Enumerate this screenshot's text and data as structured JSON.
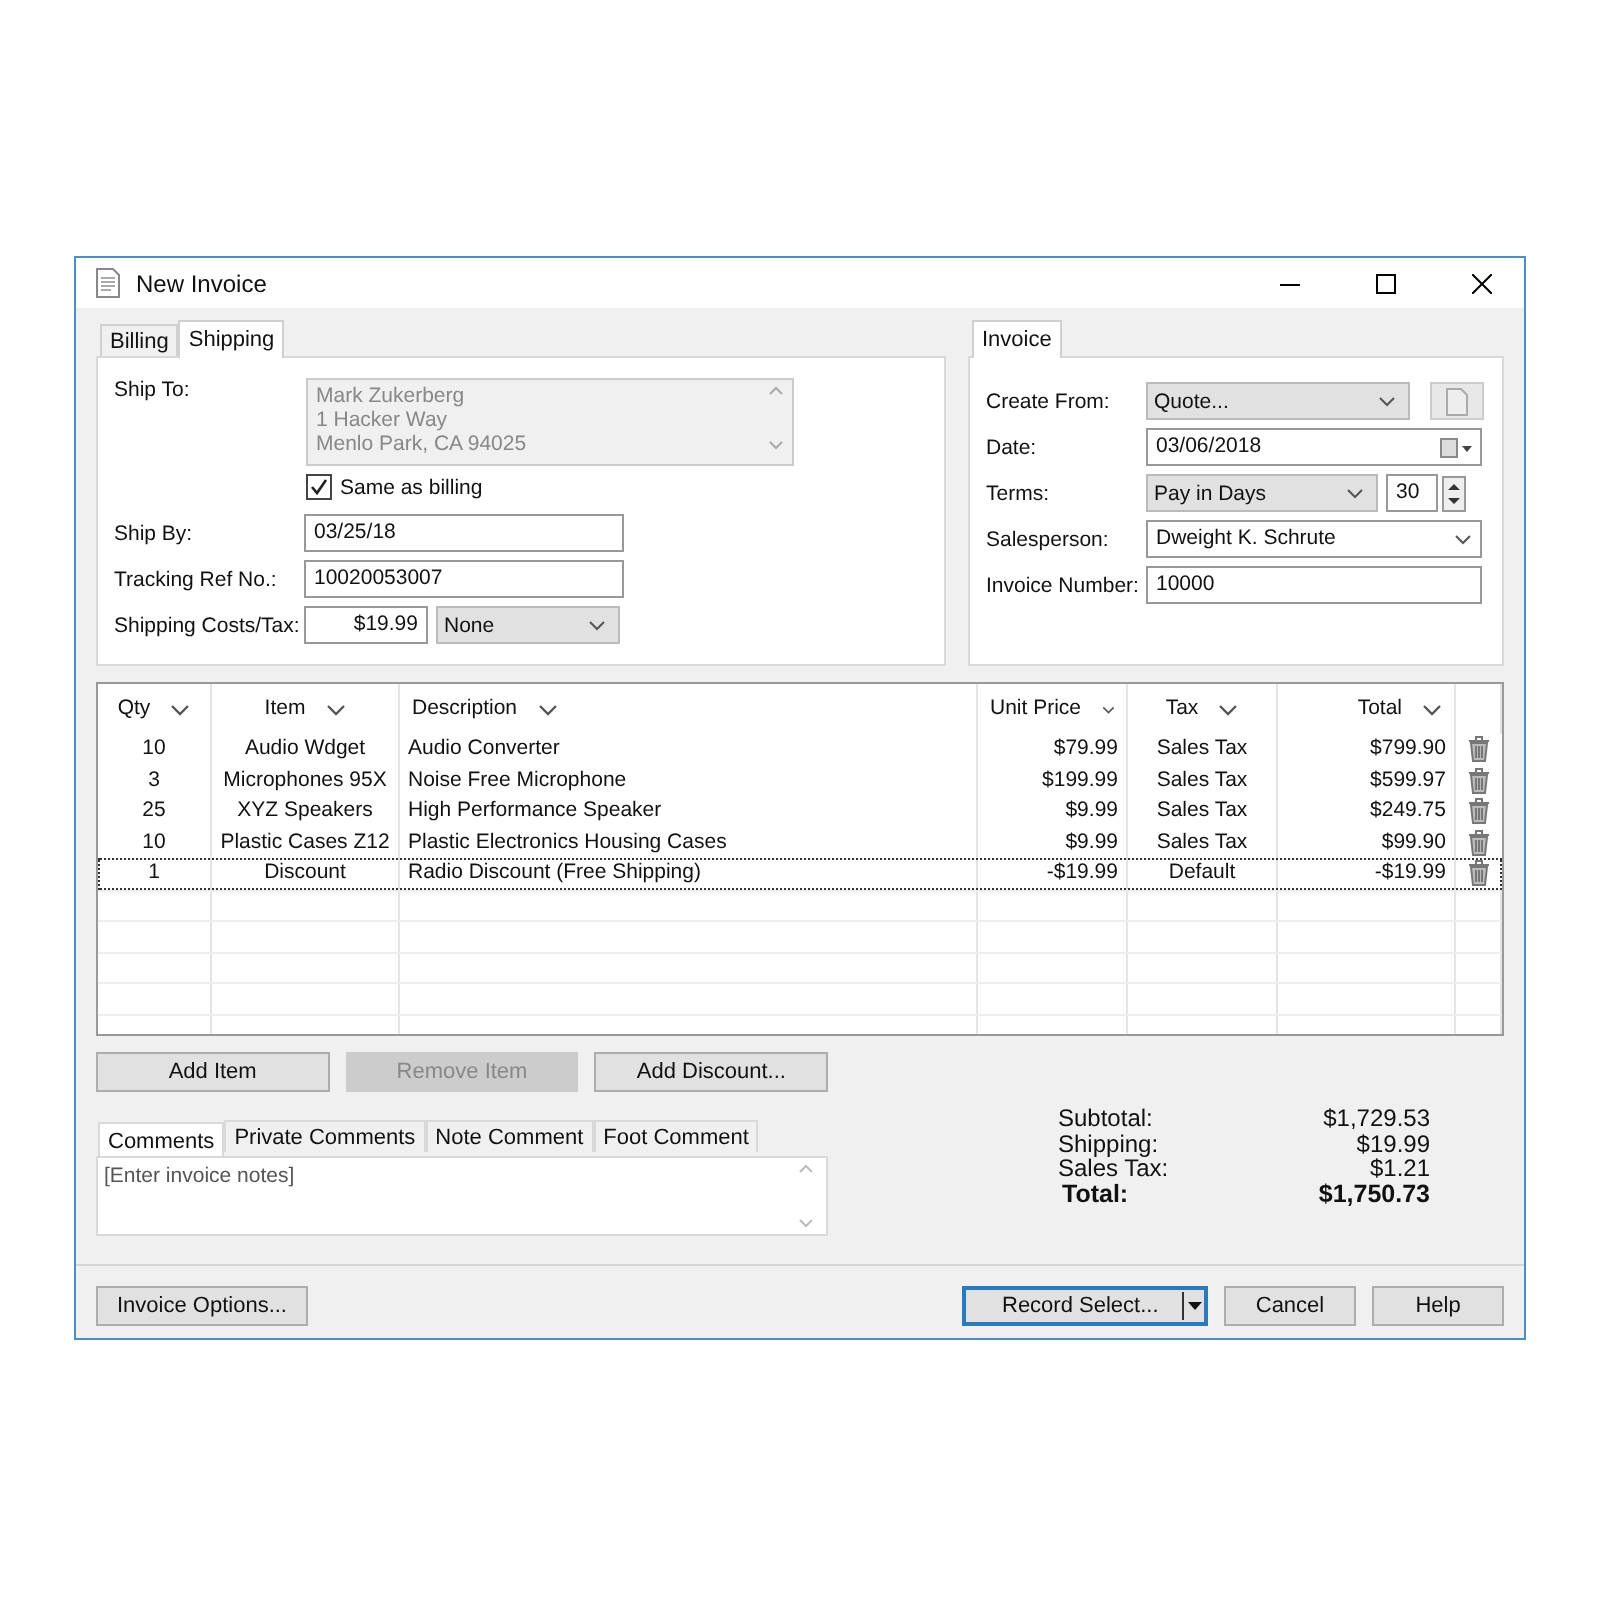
{
  "window": {
    "title": "New Invoice"
  },
  "shipping_panel": {
    "tabs": [
      {
        "label": "Billing",
        "selected": false
      },
      {
        "label": "Shipping",
        "selected": true
      }
    ],
    "ship_to": {
      "label": "Ship To:",
      "lines": [
        "Mark Zukerberg",
        "1 Hacker Way",
        "Menlo Park, CA 94025"
      ],
      "disabled": true
    },
    "same_as_billing": {
      "label": "Same as billing",
      "checked": true
    },
    "ship_by": {
      "label": "Ship By:",
      "value": "03/25/18"
    },
    "tracking": {
      "label": "Tracking Ref No.:",
      "value": "10020053007"
    },
    "shipping_costs": {
      "label": "Shipping Costs/Tax:",
      "value": "$19.99",
      "tax": "None"
    }
  },
  "invoice_panel": {
    "tabs": [
      {
        "label": "Invoice",
        "selected": true
      }
    ],
    "create_from": {
      "label": "Create From:",
      "value": "Quote...",
      "disabled": true
    },
    "date": {
      "label": "Date:",
      "value": "03/06/2018"
    },
    "terms": {
      "label": "Terms:",
      "value": "Pay in Days",
      "days": "30"
    },
    "salesperson": {
      "label": "Salesperson:",
      "value": "Dweight K. Schrute"
    },
    "invoice_number": {
      "label": "Invoice Number:",
      "value": "10000"
    }
  },
  "table": {
    "columns": [
      "Qty",
      "Item",
      "Description",
      "Unit Price",
      "Tax",
      "Total"
    ],
    "rows": [
      {
        "qty": "10",
        "item": "Audio Wdget",
        "description": "Audio Converter",
        "unit_price": "$79.99",
        "tax": "Sales Tax",
        "total": "$799.90",
        "selected": false
      },
      {
        "qty": "3",
        "item": "Microphones 95X",
        "description": "Noise Free Microphone",
        "unit_price": "$199.99",
        "tax": "Sales Tax",
        "total": "$599.97",
        "selected": false
      },
      {
        "qty": "25",
        "item": "XYZ Speakers",
        "description": "High Performance Speaker",
        "unit_price": "$9.99",
        "tax": "Sales Tax",
        "total": "$249.75",
        "selected": false
      },
      {
        "qty": "10",
        "item": "Plastic Cases Z12",
        "description": "Plastic Electronics Housing Cases",
        "unit_price": "$9.99",
        "tax": "Sales Tax",
        "total": "$99.90",
        "selected": false
      },
      {
        "qty": "1",
        "item": "Discount",
        "description": "Radio Discount (Free Shipping)",
        "unit_price": "-$19.99",
        "tax": "Default",
        "total": "-$19.99",
        "selected": true
      }
    ]
  },
  "item_buttons": [
    {
      "label": "Add Item",
      "disabled": false
    },
    {
      "label": "Remove Item",
      "disabled": true
    },
    {
      "label": "Add Discount...",
      "disabled": false
    }
  ],
  "comments": {
    "tabs": [
      {
        "label": "Comments",
        "selected": true
      },
      {
        "label": "Private Comments",
        "selected": false
      },
      {
        "label": "Note Comment",
        "selected": false
      },
      {
        "label": "Foot Comment",
        "selected": false
      }
    ],
    "placeholder": "[Enter invoice notes]"
  },
  "totals": [
    {
      "kind": "line",
      "label": "Subtotal:",
      "value": "$1,729.53"
    },
    {
      "kind": "line",
      "label": "Shipping:",
      "value": "$19.99"
    },
    {
      "kind": "line",
      "label": "Sales Tax:",
      "value": "$1.21"
    },
    {
      "kind": "total",
      "label": "Total:",
      "value": "$1,750.73"
    }
  ],
  "footer": {
    "options_button": "Invoice Options...",
    "record_button": "Record Select...",
    "buttons": [
      "Cancel",
      "Help"
    ]
  }
}
